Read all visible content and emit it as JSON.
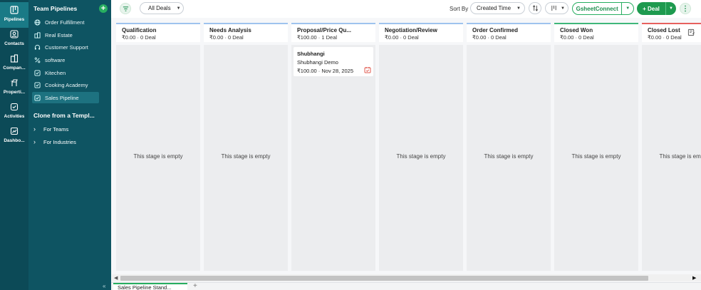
{
  "rail": {
    "items": [
      {
        "label": "Pipelines",
        "icon": "pipeline-icon",
        "active": true
      },
      {
        "label": "Contacts",
        "icon": "contacts-icon",
        "active": false
      },
      {
        "label": "Compan...",
        "icon": "companies-icon",
        "active": false
      },
      {
        "label": "Properti...",
        "icon": "properties-icon",
        "active": false
      },
      {
        "label": "Activities",
        "icon": "activities-icon",
        "active": false
      },
      {
        "label": "Dashbo...",
        "icon": "dashboard-icon",
        "active": false
      }
    ]
  },
  "sidebar": {
    "title": "Team Pipelines",
    "add_label": "+",
    "items": [
      {
        "label": "Order Fulfillment",
        "icon": "globe-icon"
      },
      {
        "label": "Real Estate",
        "icon": "building-icon"
      },
      {
        "label": "Customer Support",
        "icon": "headset-icon"
      },
      {
        "label": "software",
        "icon": "percent-icon"
      },
      {
        "label": "Kitechen",
        "icon": "kitchen-icon"
      },
      {
        "label": "Cooking Academy",
        "icon": "cooking-icon"
      },
      {
        "label": "Sales Pipeline",
        "icon": "sales-icon"
      }
    ],
    "clone_title": "Clone from a Templ...",
    "clone_items": [
      {
        "label": "For Teams"
      },
      {
        "label": "For Industries"
      }
    ],
    "collapse_label": "«"
  },
  "toolbar": {
    "filter_icon": "filter-icon",
    "view_select": "All Deals",
    "sort_by_label": "Sort By",
    "sort_select": "Created Time",
    "gsheet_label": "GsheetConnect",
    "deal_label": "+ Deal",
    "more_label": "⋮"
  },
  "columns": [
    {
      "title": "Qualification",
      "amount": "₹0.00",
      "count": "0 Deal",
      "empty": "This stage is empty",
      "accent": "#9ec3ee"
    },
    {
      "title": "Needs Analysis",
      "amount": "₹0.00",
      "count": "0 Deal",
      "empty": "This stage is empty",
      "accent": "#9ec3ee"
    },
    {
      "title": "Proposal/Price Qu...",
      "amount": "₹100.00",
      "count": "1 Deal",
      "empty": "",
      "accent": "#9ec3ee"
    },
    {
      "title": "Negotiation/Review",
      "amount": "₹0.00",
      "count": "0 Deal",
      "empty": "This stage is empty",
      "accent": "#9ec3ee"
    },
    {
      "title": "Order Confirmed",
      "amount": "₹0.00",
      "count": "0 Deal",
      "empty": "This stage is empty",
      "accent": "#9ec3ee"
    },
    {
      "title": "Closed Won",
      "amount": "₹0.00",
      "count": "0 Deal",
      "empty": "This stage is empty",
      "accent": "#3fb77a"
    },
    {
      "title": "Closed Lost",
      "amount": "₹0.00",
      "count": "0 Deal",
      "empty": "This stage is empty",
      "accent": "#e6615e"
    }
  ],
  "deal_card": {
    "name": "Shubhangi",
    "deal": "Shubhangi Demo",
    "amount": "₹100.00",
    "date": "Nov 28, 2025"
  },
  "tabs": [
    {
      "label": "Sales Pipeline Stand..."
    }
  ],
  "tab_add_label": "+"
}
